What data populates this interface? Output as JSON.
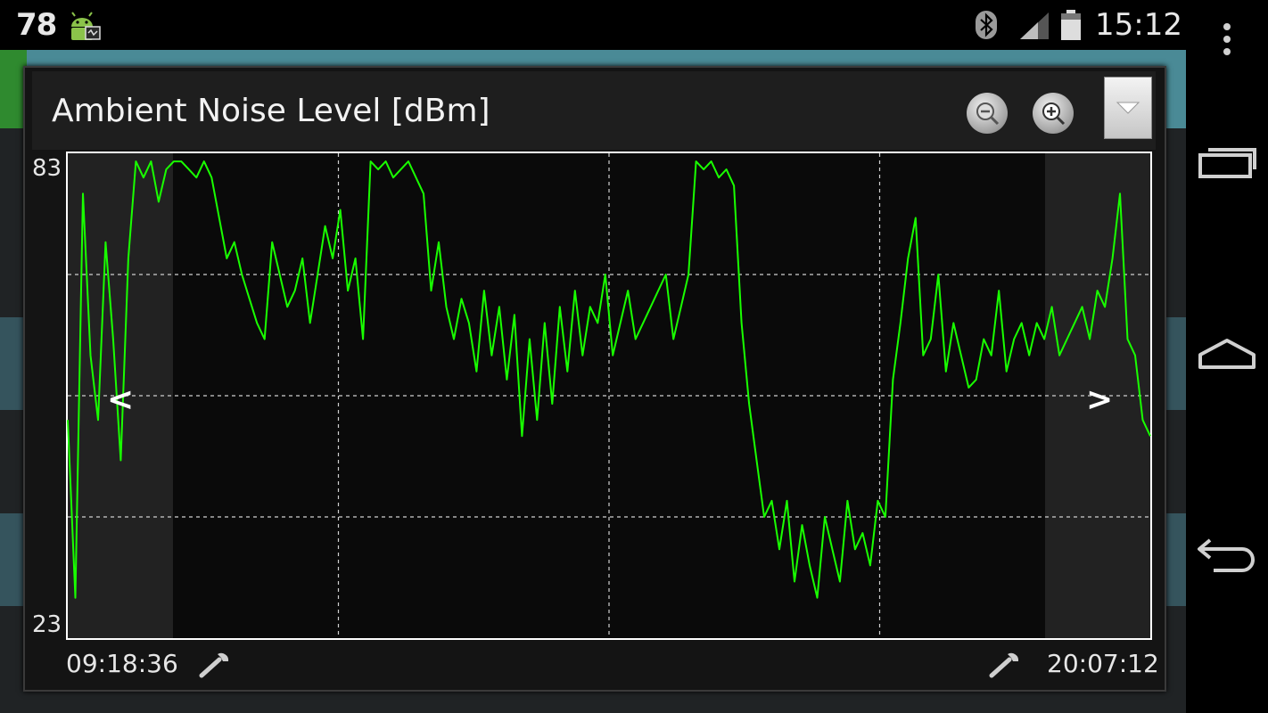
{
  "status_bar": {
    "battery_level": "78",
    "time": "15:12",
    "icons": [
      "android-debug-icon",
      "bluetooth-icon",
      "signal-icon",
      "battery-icon"
    ]
  },
  "dialog": {
    "title": "Ambient Noise Level [dBm]",
    "buttons": {
      "zoom_out": "zoom-out-icon",
      "zoom_in": "zoom-in-icon",
      "dropdown": "dropdown-arrow-icon"
    },
    "scroll_left": "<",
    "scroll_right": ">",
    "time_start": "09:18:36",
    "time_end": "20:07:12"
  },
  "colors": {
    "series": "#19ff00",
    "plot_bg": "#0a0a0a",
    "grid": "#d0d0d0",
    "title_bar": "#1e1e1e"
  },
  "chart_data": {
    "type": "line",
    "title": "Ambient Noise Level [dBm]",
    "ylim": [
      23,
      83
    ],
    "x_start": "09:18:36",
    "x_end": "20:07:12",
    "ytick_labels": [
      "83",
      "23"
    ],
    "grid": true,
    "series": [
      {
        "values": [
          50,
          28,
          78,
          58,
          50,
          72,
          60,
          45,
          70,
          82,
          80,
          82,
          77,
          81,
          82,
          82,
          81,
          80,
          82,
          80,
          75,
          70,
          72,
          68,
          65,
          62,
          60,
          72,
          68,
          64,
          66,
          70,
          62,
          68,
          74,
          70,
          76,
          66,
          70,
          60,
          82,
          81,
          82,
          80,
          81,
          82,
          80,
          78,
          66,
          72,
          64,
          60,
          65,
          62,
          56,
          66,
          58,
          64,
          55,
          63,
          48,
          60,
          50,
          62,
          52,
          64,
          56,
          66,
          58,
          64,
          62,
          68,
          58,
          62,
          66,
          60,
          62,
          64,
          66,
          68,
          60,
          64,
          68,
          82,
          81,
          82,
          80,
          81,
          79,
          62,
          52,
          45,
          38,
          40,
          34,
          40,
          30,
          37,
          32,
          28,
          38,
          34,
          30,
          40,
          34,
          36,
          32,
          40,
          38,
          55,
          62,
          70,
          75,
          58,
          60,
          68,
          56,
          62,
          58,
          54,
          55,
          60,
          58,
          66,
          56,
          60,
          62,
          58,
          62,
          60,
          64,
          58,
          60,
          62,
          64,
          60,
          66,
          64,
          70,
          78,
          60,
          58,
          50,
          48
        ]
      }
    ]
  }
}
